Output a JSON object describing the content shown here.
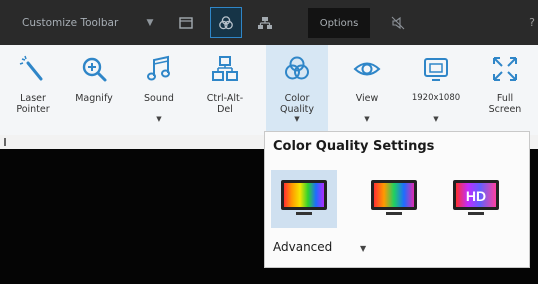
{
  "topbar": {
    "customize_label": "Customize Toolbar",
    "options_label": "Options",
    "help_label": "?"
  },
  "ribbon": {
    "buttons": [
      {
        "label": "Laser\nPointer",
        "icon": "laser-pointer-icon"
      },
      {
        "label": "Magnify",
        "icon": "magnify-icon"
      },
      {
        "label": "Sound",
        "icon": "sound-icon"
      },
      {
        "label": "Ctrl-Alt-\nDel",
        "icon": "ctrl-alt-del-icon"
      },
      {
        "label": "Color\nQuality",
        "icon": "color-quality-icon"
      },
      {
        "label": "View",
        "icon": "view-icon"
      },
      {
        "label": "1920x1080",
        "icon": "resolution-icon"
      },
      {
        "label": "Full\nScreen",
        "icon": "fullscreen-icon"
      }
    ]
  },
  "popup": {
    "title": "Color Quality Settings",
    "options": [
      {
        "name": "best-quality",
        "badge": ""
      },
      {
        "name": "balanced",
        "badge": ""
      },
      {
        "name": "hd",
        "badge": "HD"
      }
    ],
    "advanced_label": "Advanced"
  },
  "colors": {
    "accent": "#2f86c8",
    "topbar_bg": "#2a2a2a",
    "ribbon_bg": "#f4f6f8",
    "selected_bg": "#cfe0f0"
  }
}
